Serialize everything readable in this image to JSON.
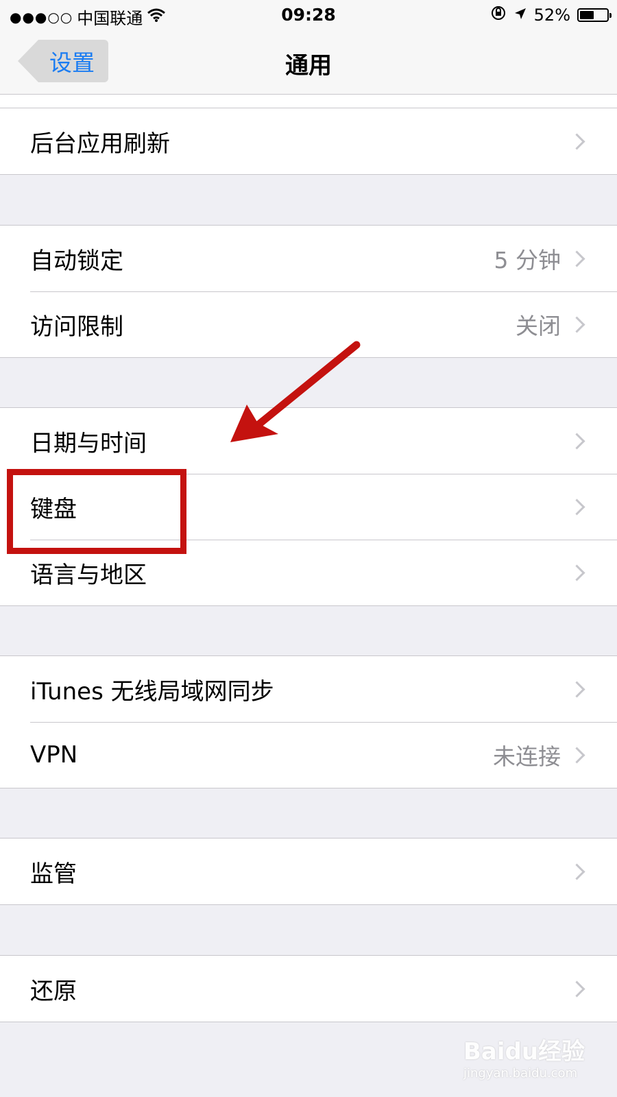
{
  "status_bar": {
    "signal": "●●●○○",
    "carrier": "中国联通",
    "time": "09:28",
    "battery_percent": "52%",
    "battery_level": 0.52
  },
  "nav": {
    "back_label": "设置",
    "title": "通用"
  },
  "groups": [
    {
      "items": [
        {
          "label": "后台应用刷新",
          "detail": ""
        }
      ]
    },
    {
      "items": [
        {
          "label": "自动锁定",
          "detail": "5 分钟"
        },
        {
          "label": "访问限制",
          "detail": "关闭"
        }
      ]
    },
    {
      "items": [
        {
          "label": "日期与时间",
          "detail": ""
        },
        {
          "label": "键盘",
          "detail": ""
        },
        {
          "label": "语言与地区",
          "detail": ""
        }
      ]
    },
    {
      "items": [
        {
          "label": "iTunes 无线局域网同步",
          "detail": ""
        },
        {
          "label": "VPN",
          "detail": "未连接"
        }
      ]
    },
    {
      "items": [
        {
          "label": "监管",
          "detail": ""
        }
      ]
    },
    {
      "items": [
        {
          "label": "还原",
          "detail": ""
        }
      ]
    }
  ],
  "annotation": {
    "color": "#c4120f",
    "highlighted_item": "键盘"
  },
  "colors": {
    "accent": "#1a7cf2",
    "background": "#efeff4",
    "detail_text": "#8e8e93"
  },
  "watermark": {
    "brand": "Baidu经验",
    "url": "jingyan.baidu.com"
  }
}
